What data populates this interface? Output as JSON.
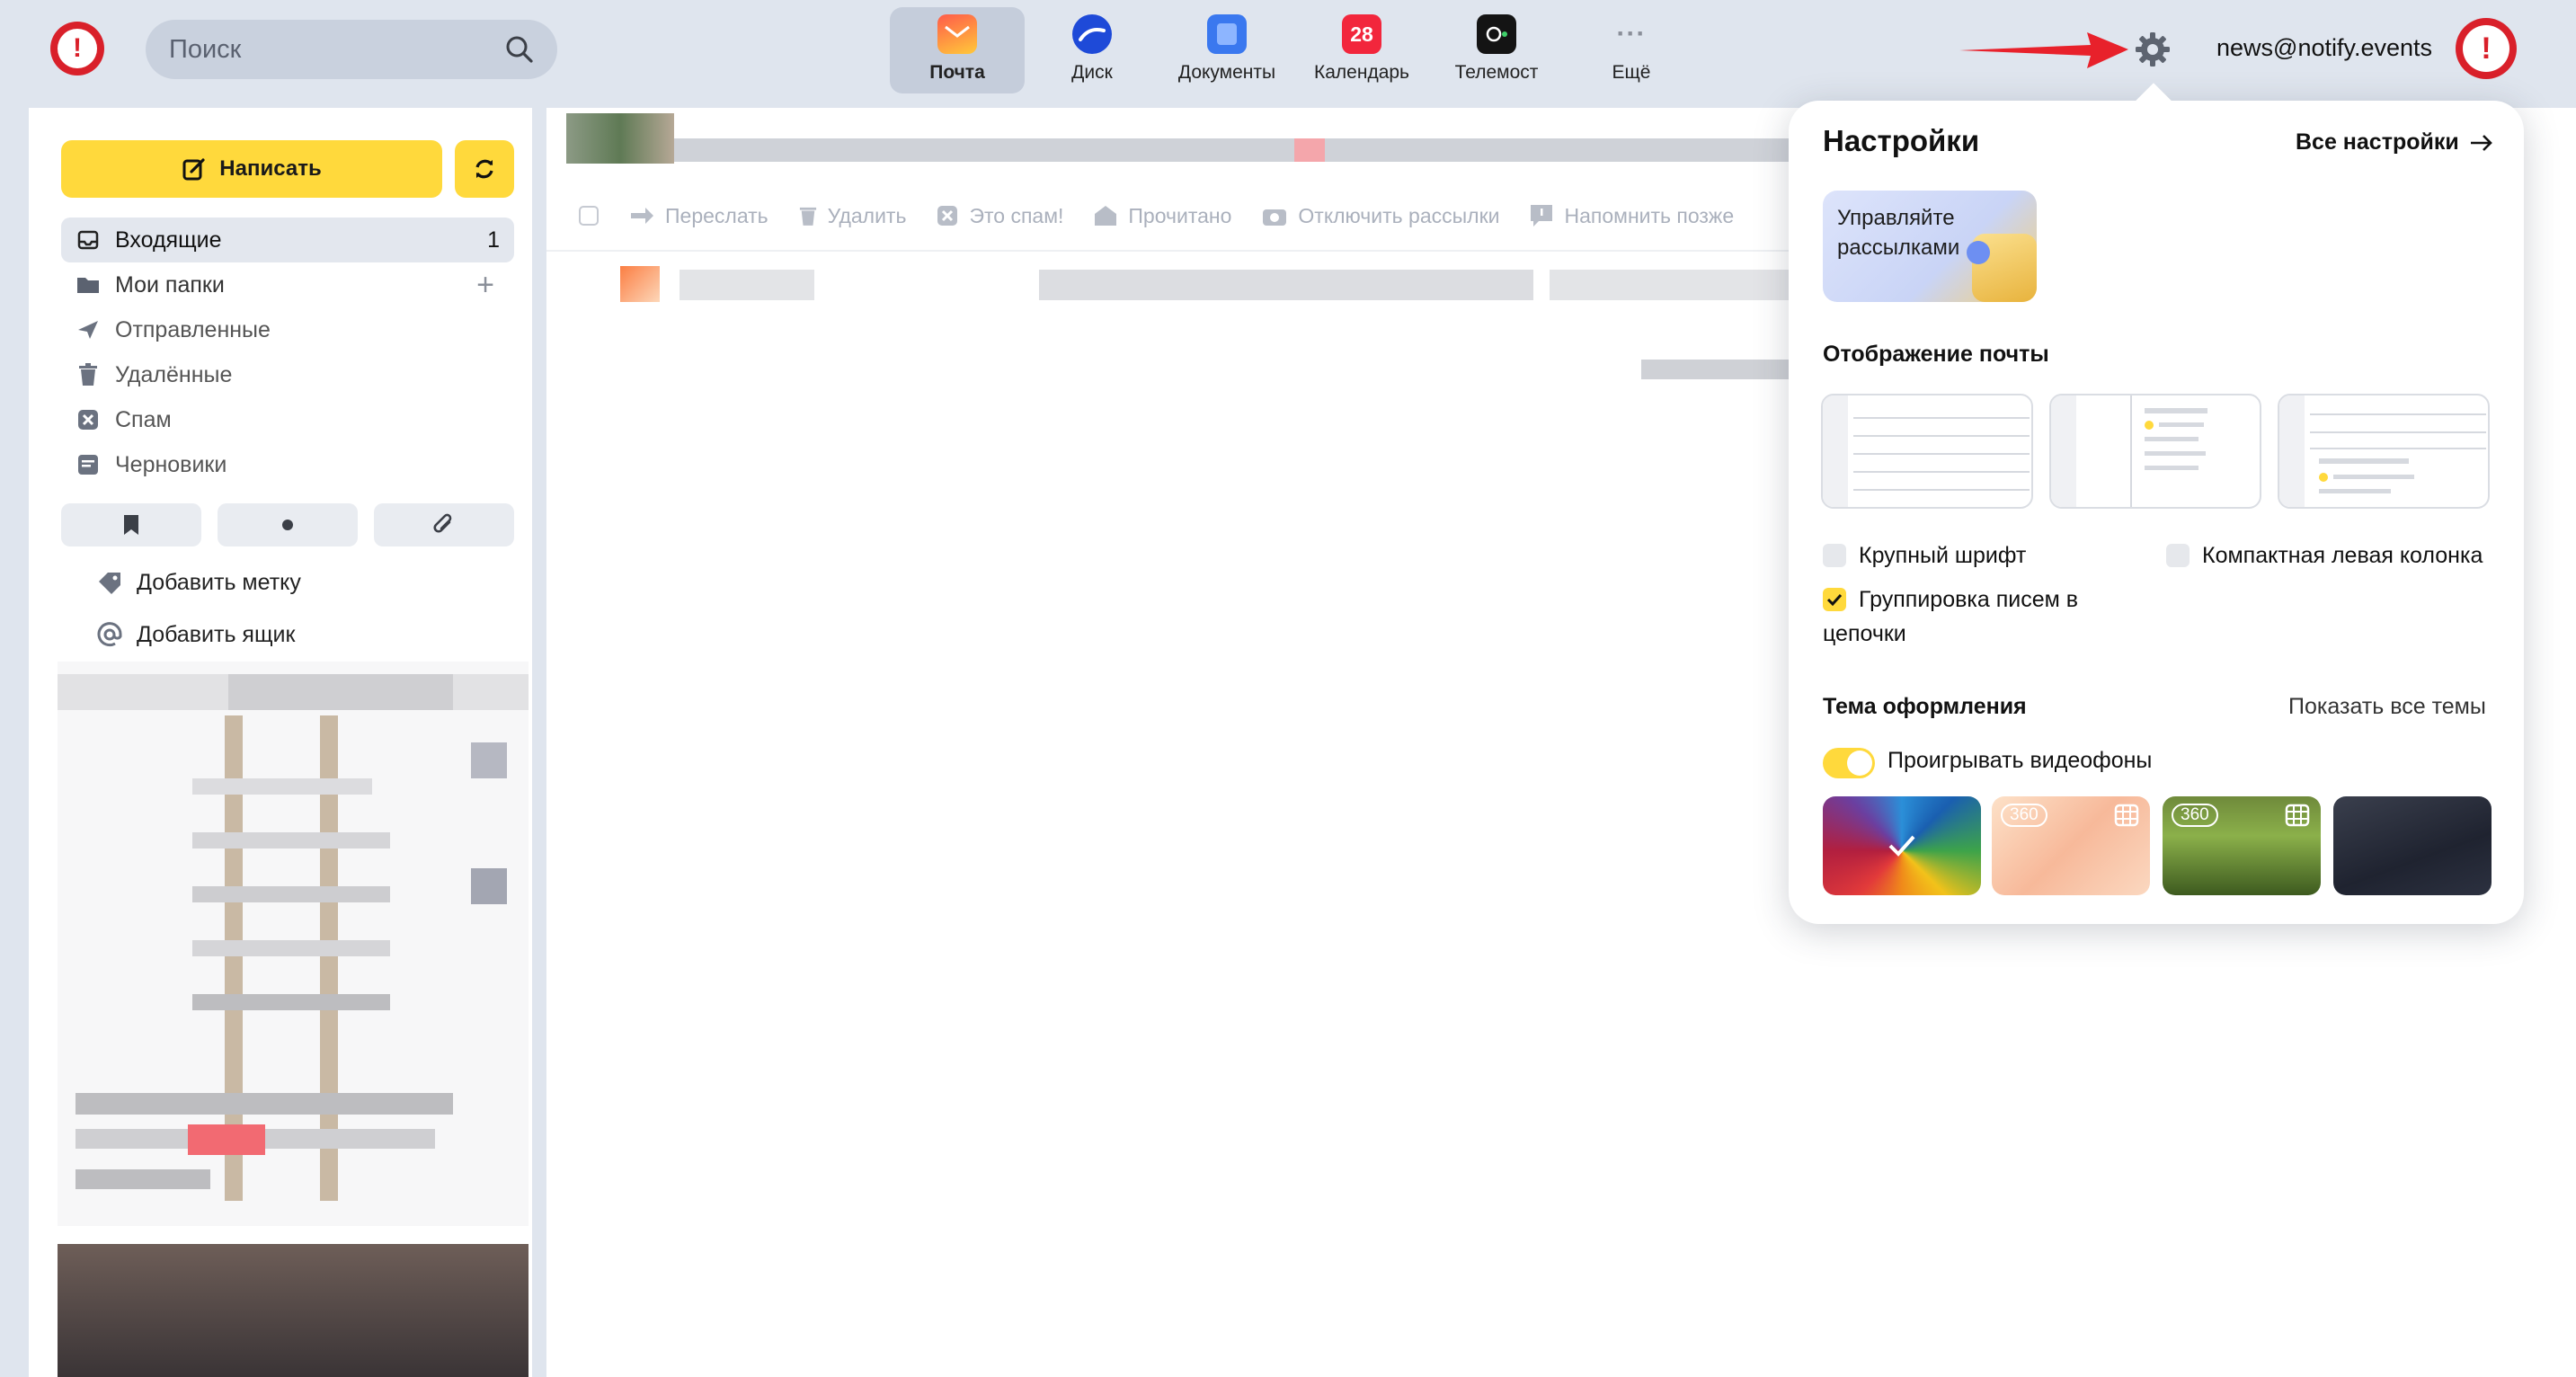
{
  "header": {
    "search_placeholder": "Поиск",
    "services": [
      {
        "label": "Почта",
        "icon": "mail-icon",
        "active": true
      },
      {
        "label": "Диск",
        "icon": "disk-icon"
      },
      {
        "label": "Документы",
        "icon": "documents-icon"
      },
      {
        "label": "Календарь",
        "icon": "calendar-icon",
        "badge": "28"
      },
      {
        "label": "Телемост",
        "icon": "telemost-icon"
      },
      {
        "label": "Ещё",
        "icon": "more-icon"
      }
    ],
    "email": "news@notify.events"
  },
  "sidebar": {
    "compose_label": "Написать",
    "folders": [
      {
        "label": "Входящие",
        "icon": "inbox-icon",
        "count": "1",
        "selected": true
      },
      {
        "label": "Мои папки",
        "icon": "folder-icon"
      },
      {
        "label": "Отправленные",
        "icon": "sent-icon"
      },
      {
        "label": "Удалённые",
        "icon": "trash-icon"
      },
      {
        "label": "Спам",
        "icon": "spam-icon"
      },
      {
        "label": "Черновики",
        "icon": "drafts-icon"
      }
    ],
    "add_label": "Добавить метку",
    "add_mailbox": "Добавить ящик"
  },
  "toolbar": {
    "forward": "Переслать",
    "delete": "Удалить",
    "spam": "Это спам!",
    "read": "Прочитано",
    "unsubscribe": "Отключить рассылки",
    "remind": "Напомнить позже"
  },
  "settings": {
    "title": "Настройки",
    "all_settings": "Все настройки",
    "promo": "Управляйте рассылками",
    "display_section": "Отображение почты",
    "large_font": "Крупный шрифт",
    "large_font_checked": false,
    "compact_left": "Компактная левая колонка",
    "compact_left_checked": false,
    "grouping": "Группировка писем в цепочки",
    "grouping_checked": true,
    "theme_section": "Тема оформления",
    "show_all_themes": "Показать все темы",
    "video_bg": "Проигрывать видеофоны",
    "video_bg_on": true,
    "theme_badge": "360"
  },
  "colors": {
    "accent_yellow": "#ffd93c",
    "arrow_red": "#e8212b",
    "bg": "#dfe5ee"
  }
}
